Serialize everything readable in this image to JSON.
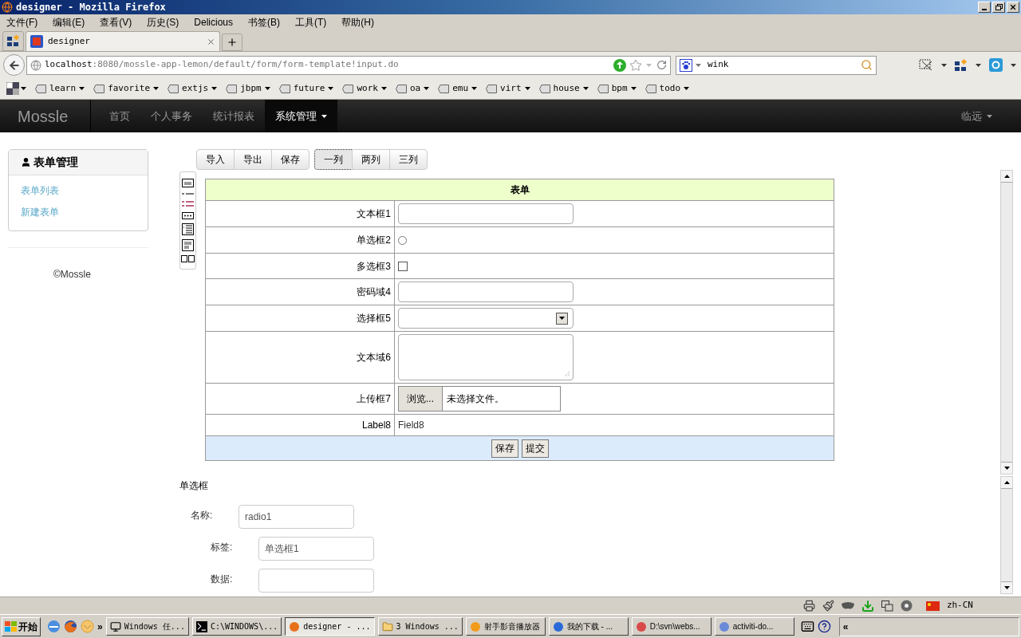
{
  "window": {
    "title": "designer - Mozilla Firefox"
  },
  "menu": [
    "文件(F)",
    "编辑(E)",
    "查看(V)",
    "历史(S)",
    "Delicious",
    "书签(B)",
    "工具(T)",
    "帮助(H)"
  ],
  "browser_tabs": [
    {
      "label": "designer",
      "selected": true
    }
  ],
  "address": {
    "host": "localhost",
    "path": ":8080/mossle-app-lemon/default/form/form-template!input.do"
  },
  "search": {
    "value": "wink"
  },
  "bookmarks": [
    "learn",
    "favorite",
    "extjs",
    "jbpm",
    "future",
    "work",
    "oa",
    "emu",
    "virt",
    "house",
    "bpm",
    "todo"
  ],
  "navbar": {
    "brand": "Mossle",
    "items": [
      {
        "label": "首页",
        "selected": false,
        "dropdown": false
      },
      {
        "label": "个人事务",
        "selected": false,
        "dropdown": false
      },
      {
        "label": "统计报表",
        "selected": false,
        "dropdown": false
      },
      {
        "label": "系统管理",
        "selected": true,
        "dropdown": true
      }
    ],
    "user": "临远"
  },
  "sidebar": {
    "title": "表单管理",
    "links": [
      "表单列表",
      "新建表单"
    ],
    "footer": "©Mossle"
  },
  "toolbar": {
    "actions": [
      "导入",
      "导出",
      "保存"
    ],
    "layouts": [
      {
        "label": "一列",
        "selected": true
      },
      {
        "label": "两列",
        "selected": false
      },
      {
        "label": "三列",
        "selected": false
      }
    ]
  },
  "form": {
    "title": "表单",
    "rows": [
      {
        "label": "文本框1",
        "kind": "text"
      },
      {
        "label": "单选框2",
        "kind": "radio",
        "checked": false
      },
      {
        "label": "多选框3",
        "kind": "checkbox",
        "checked": false
      },
      {
        "label": "密码域4",
        "kind": "password"
      },
      {
        "label": "选择框5",
        "kind": "select"
      },
      {
        "label": "文本域6",
        "kind": "textarea"
      },
      {
        "label": "上传框7",
        "kind": "file",
        "button": "浏览...",
        "status": "未选择文件。"
      },
      {
        "label": "Label8",
        "kind": "label",
        "value": "Field8"
      }
    ],
    "buttons": [
      "保存",
      "提交"
    ]
  },
  "properties": {
    "title": "单选框",
    "fields": [
      {
        "label": "名称:",
        "value": "radio1"
      },
      {
        "label": "标签:",
        "value": "单选框1"
      },
      {
        "label": "数据:"
      }
    ]
  },
  "status_bar": {
    "locale": "zh-CN"
  },
  "taskbar": {
    "start": "开始",
    "more": "»",
    "tasks": [
      {
        "label": "Windows 任...",
        "selected": false
      },
      {
        "label": "C:\\WINDOWS\\...",
        "selected": false
      },
      {
        "label": "designer - ...",
        "selected": true
      },
      {
        "label": "3 Windows ...",
        "selected": false
      },
      {
        "label": "射手影音播放器",
        "selected": false
      },
      {
        "label": "我的下载 - ...",
        "selected": false
      },
      {
        "label": "D:\\svn\\webs...",
        "selected": false
      },
      {
        "label": "activiti-do...",
        "selected": false
      }
    ],
    "tray_toggle": "«"
  }
}
